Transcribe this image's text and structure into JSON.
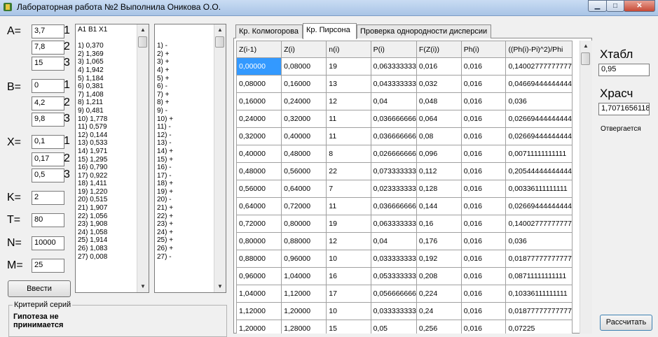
{
  "window": {
    "title": "Лабораторная работа №2 Выполнила Оникова О.О.",
    "btn_min": "▁",
    "btn_max": "□",
    "btn_close": "✕"
  },
  "params": {
    "a_label": "A=",
    "b_label": "B=",
    "x_label": "X=",
    "n1": "1",
    "n2": "2",
    "n3": "3",
    "a": [
      "3,7",
      "7,8",
      "15"
    ],
    "b": [
      "0",
      "4,2",
      "9,8"
    ],
    "x": [
      "0,1",
      "0,17",
      "0,5"
    ],
    "k_label": "K=",
    "k_value": "2",
    "t_label": "T=",
    "t_value": "80",
    "n_label": "N=",
    "n_value": "10000",
    "m_label": "M=",
    "m_value": "25",
    "enter_button": "Ввести"
  },
  "list_values": [
    "A1 B1 X1",
    "",
    "1) 0,370",
    "2) 1,369",
    "3) 1,065",
    "4) 1,942",
    "5) 1,184",
    "6) 0,381",
    "7) 1,408",
    "8) 1,211",
    "9) 0,481",
    "10) 1,778",
    "11) 0,579",
    "12) 0,144",
    "13) 0,533",
    "14) 1,971",
    "15) 1,295",
    "16) 0,790",
    "17) 0,922",
    "18) 1,411",
    "19) 1,220",
    "20) 0,515",
    "21) 1,907",
    "22) 1,056",
    "23) 1,908",
    "24) 1,058",
    "25) 1,914",
    "26) 1,083",
    "27) 0,008"
  ],
  "list_signs": [
    "",
    "",
    "1) -",
    "2) +",
    "3) +",
    "4) +",
    "5) +",
    "6) -",
    "7) +",
    "8) +",
    "9) -",
    "10) +",
    "11) -",
    "12) -",
    "13) -",
    "14) +",
    "15) +",
    "16) -",
    "17) -",
    "18) +",
    "19) +",
    "20) -",
    "21) +",
    "22) +",
    "23) +",
    "24) +",
    "25) +",
    "26) +",
    "27) -"
  ],
  "series_criterion": {
    "title": "Критерий серий",
    "result": "Гипотеза не принимается"
  },
  "tabs": [
    "Кр. Колмогорова",
    "Кр. Пирсона",
    "Проверка однородности дисперсии"
  ],
  "table": {
    "headers": [
      "Z(i-1)",
      "Z(i)",
      "n(i)",
      "P(i)",
      "F(Z(i))",
      "Ph(i)",
      "((Ph(i)-Pi)^2)/Phi"
    ],
    "rows": [
      [
        "0,00000",
        "0,08000",
        "19",
        "0,063333333",
        "0,016",
        "0,016",
        "0,14002777777777"
      ],
      [
        "0,08000",
        "0,16000",
        "13",
        "0,043333333",
        "0,032",
        "0,016",
        "0,04669444444444"
      ],
      [
        "0,16000",
        "0,24000",
        "12",
        "0,04",
        "0,048",
        "0,016",
        "0,036"
      ],
      [
        "0,24000",
        "0,32000",
        "11",
        "0,036666666",
        "0,064",
        "0,016",
        "0,02669444444444"
      ],
      [
        "0,32000",
        "0,40000",
        "11",
        "0,036666666",
        "0,08",
        "0,016",
        "0,02669444444444"
      ],
      [
        "0,40000",
        "0,48000",
        "8",
        "0,026666666",
        "0,096",
        "0,016",
        "0,00711111111111"
      ],
      [
        "0,48000",
        "0,56000",
        "22",
        "0,073333333",
        "0,112",
        "0,016",
        "0,20544444444444"
      ],
      [
        "0,56000",
        "0,64000",
        "7",
        "0,023333333",
        "0,128",
        "0,016",
        "0,00336111111111"
      ],
      [
        "0,64000",
        "0,72000",
        "11",
        "0,036666666",
        "0,144",
        "0,016",
        "0,02669444444444"
      ],
      [
        "0,72000",
        "0,80000",
        "19",
        "0,063333333",
        "0,16",
        "0,016",
        "0,14002777777777"
      ],
      [
        "0,80000",
        "0,88000",
        "12",
        "0,04",
        "0,176",
        "0,016",
        "0,036"
      ],
      [
        "0,88000",
        "0,96000",
        "10",
        "0,033333333",
        "0,192",
        "0,016",
        "0,01877777777777"
      ],
      [
        "0,96000",
        "1,04000",
        "16",
        "0,053333333",
        "0,208",
        "0,016",
        "0,08711111111111"
      ],
      [
        "1,04000",
        "1,12000",
        "17",
        "0,056666666",
        "0,224",
        "0,016",
        "0,10336111111111"
      ],
      [
        "1,12000",
        "1,20000",
        "10",
        "0,033333333",
        "0,24",
        "0,016",
        "0,01877777777777"
      ],
      [
        "1,20000",
        "1,28000",
        "15",
        "0,05",
        "0,256",
        "0,016",
        "0,07225"
      ]
    ]
  },
  "right": {
    "xtabl_label": "Xтабл",
    "xtabl_value": "0,95",
    "xrasch_label": "Xрасч",
    "xrasch_value": "1,70716561182",
    "status": "Отвергается",
    "calc_button": "Рассчитать"
  }
}
